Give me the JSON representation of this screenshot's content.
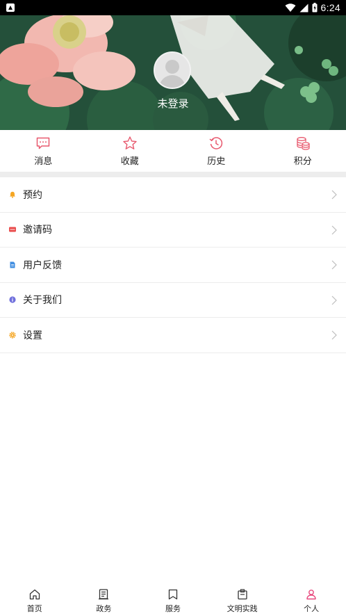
{
  "status_bar": {
    "time": "6:24"
  },
  "profile": {
    "login_text": "未登录"
  },
  "quick_actions": [
    {
      "label": "消息",
      "icon": "message-icon"
    },
    {
      "label": "收藏",
      "icon": "star-icon"
    },
    {
      "label": "历史",
      "icon": "history-icon"
    },
    {
      "label": "积分",
      "icon": "points-icon"
    }
  ],
  "menu": [
    {
      "label": "预约",
      "icon": "bell-icon",
      "color": "#f5a623"
    },
    {
      "label": "邀请码",
      "icon": "ticket-icon",
      "color": "#e94b4b"
    },
    {
      "label": "用户反馈",
      "icon": "document-icon",
      "color": "#3f8de0"
    },
    {
      "label": "关于我们",
      "icon": "info-icon",
      "color": "#6f6fdc"
    },
    {
      "label": "设置",
      "icon": "gear-icon",
      "color": "#f5a623"
    }
  ],
  "bottom_nav": [
    {
      "label": "首页",
      "icon": "home-icon"
    },
    {
      "label": "政务",
      "icon": "news-icon"
    },
    {
      "label": "服务",
      "icon": "bookmark-icon"
    },
    {
      "label": "文明实践",
      "icon": "clipboard-icon"
    },
    {
      "label": "个人",
      "icon": "person-icon",
      "active": true
    }
  ],
  "colors": {
    "accent": "#e8467c",
    "icon_pink": "#e8596e",
    "divider": "#ededed"
  }
}
